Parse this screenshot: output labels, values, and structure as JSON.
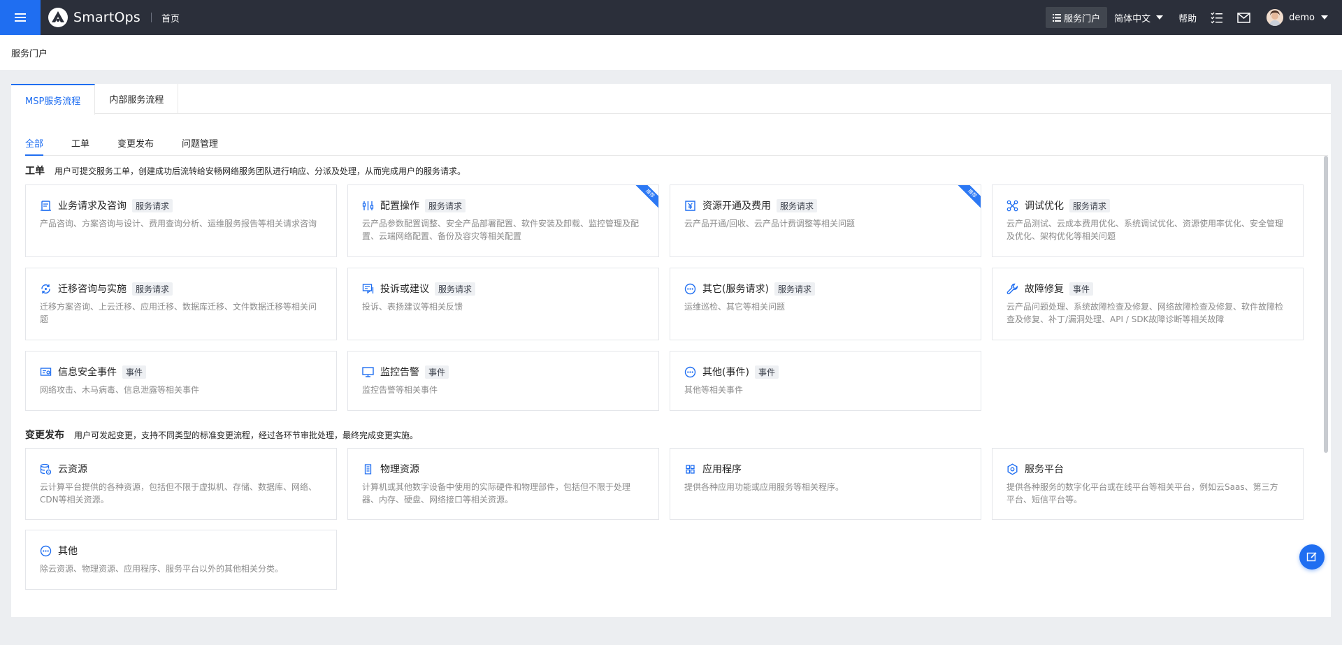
{
  "topbar": {
    "app_name": "SmartOps",
    "home": "首页",
    "portal_button": "服务门户",
    "language": "简体中文",
    "help": "帮助",
    "username": "demo"
  },
  "page": {
    "title": "服务门户"
  },
  "main_tabs": [
    {
      "label": "MSP服务流程",
      "active": true
    },
    {
      "label": "内部服务流程",
      "active": false
    }
  ],
  "sub_tabs": [
    {
      "label": "全部",
      "active": true
    },
    {
      "label": "工单",
      "active": false
    },
    {
      "label": "变更发布",
      "active": false
    },
    {
      "label": "问题管理",
      "active": false
    }
  ],
  "sections": {
    "ticket": {
      "name": "工单",
      "desc": "用户可提交服务工单，创建成功后流转给安畅网络服务团队进行响应、分派及处理，从而完成用户的服务请求。",
      "cards": [
        {
          "title": "业务请求及咨询",
          "tag": "服务请求",
          "icon": "headset-form-icon",
          "desc": "产品咨询、方案咨询与设计、费用查询分析、运维服务报告等相关请求咨询"
        },
        {
          "title": "配置操作",
          "tag": "服务请求",
          "icon": "config-sliders-icon",
          "desc": "云产品参数配置调整、安全产品部署配置、软件安装及卸载、监控管理及配置、云端网络配置、备份及容灾等相关配置",
          "ribbon": "推荐"
        },
        {
          "title": "资源开通及费用",
          "tag": "服务请求",
          "icon": "yen-shield-icon",
          "desc": "云产品开通/回收、云产品计费调整等相关问题",
          "ribbon": "推荐"
        },
        {
          "title": "调试优化",
          "tag": "服务请求",
          "icon": "optimize-icon",
          "desc": "云产品测试、云成本费用优化、系统调试优化、资源使用率优化、安全管理及优化、架构优化等相关问题"
        },
        {
          "title": "迁移咨询与实施",
          "tag": "服务请求",
          "icon": "migrate-icon",
          "desc": "迁移方案咨询、上云迁移、应用迁移、数据库迁移、文件数据迁移等相关问题"
        },
        {
          "title": "投诉或建议",
          "tag": "服务请求",
          "icon": "feedback-icon",
          "desc": "投诉、表扬建议等相关反馈"
        },
        {
          "title": "其它(服务请求)",
          "tag": "服务请求",
          "icon": "more-circle-icon",
          "desc": "运维巡检、其它等相关问题"
        },
        {
          "title": "故障修复",
          "tag": "事件",
          "icon": "wrench-icon",
          "desc": "云产品问题处理、系统故障检查及修复、网络故障检查及修复、软件故障检查及修复、补丁/漏洞处理、API / SDK故障诊断等相关故障"
        },
        {
          "title": "信息安全事件",
          "tag": "事件",
          "icon": "security-card-icon",
          "desc": "网络攻击、木马病毒、信息泄露等相关事件"
        },
        {
          "title": "监控告警",
          "tag": "事件",
          "icon": "monitor-icon",
          "desc": "监控告警等相关事件"
        },
        {
          "title": "其他(事件)",
          "tag": "事件",
          "icon": "more-circle-icon",
          "desc": "其他等相关事件"
        }
      ]
    },
    "change": {
      "name": "变更发布",
      "desc": "用户可发起变更，支持不同类型的标准变更流程，经过各环节审批处理，最终完成变更实施。",
      "cards": [
        {
          "title": "云资源",
          "icon": "cloud-db-icon",
          "desc": "云计算平台提供的各种资源，包括但不限于虚拟机、存储、数据库、网络、CDN等相关资源。"
        },
        {
          "title": "物理资源",
          "icon": "server-icon",
          "desc": "计算机或其他数字设备中使用的实际硬件和物理部件，包括但不限于处理器、内存、硬盘、网络接口等相关资源。"
        },
        {
          "title": "应用程序",
          "icon": "apps-grid-icon",
          "desc": "提供各种应用功能或应用服务等相关程序。"
        },
        {
          "title": "服务平台",
          "icon": "hexagon-icon",
          "desc": "提供各种服务的数字化平台或在线平台等相关平台，例如云Saas、第三方平台、短信平台等。"
        },
        {
          "title": "其他",
          "icon": "more-circle-icon",
          "desc": "除云资源、物理资源、应用程序、服务平台以外的其他相关分类。"
        }
      ]
    }
  },
  "colors": {
    "primary": "#1f6ef1",
    "topbar": "#2b2f3a",
    "page_bg": "#eceef1"
  }
}
